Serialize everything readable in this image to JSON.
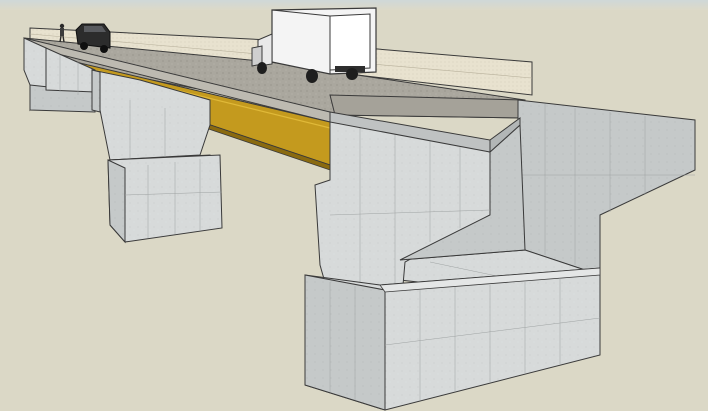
{
  "viewport": {
    "background": "#dbd8c6",
    "model": "bridge-3d-model"
  },
  "colors": {
    "concrete_light": "#d9dcdc",
    "concrete_mid": "#c9cccc",
    "concrete_dark": "#b5b9b9",
    "deck_surface": "#a8a59c",
    "steel_girder": "#c49a1e",
    "railing": "#e6e0cc",
    "edge": "#3a3a3a"
  },
  "objects": [
    {
      "name": "truck",
      "icon": "box-truck-icon"
    },
    {
      "name": "car",
      "icon": "suv-icon"
    },
    {
      "name": "person",
      "icon": "person-icon"
    }
  ]
}
